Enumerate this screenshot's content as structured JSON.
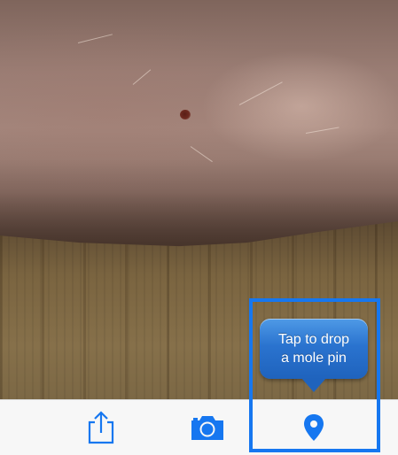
{
  "photo": {
    "subject": "skin with mole over wooden surface"
  },
  "toolbar": {
    "share_icon": "share-icon",
    "camera_icon": "camera-icon",
    "pin_icon": "map-pin-icon",
    "tint": "#1677f0"
  },
  "tooltip": {
    "line1": "Tap to drop",
    "line2": "a mole pin",
    "background": "#2a73cf"
  },
  "highlight": {
    "color": "#1677f0"
  }
}
